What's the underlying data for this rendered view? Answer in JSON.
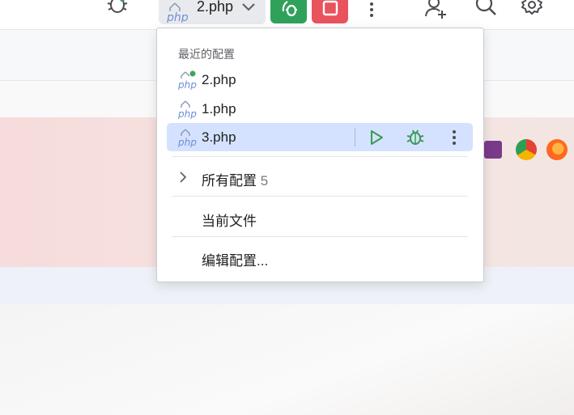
{
  "toolbar": {
    "run_config_name": "2.php",
    "php_badge": "php",
    "icons": [
      "bug-icon",
      "php-file-icon",
      "chevron-down-icon",
      "debug-icon",
      "stop-icon",
      "more-vertical-icon",
      "add-user-icon",
      "search-icon",
      "gear-icon"
    ],
    "colors": {
      "debug_bg": "#2fa15a",
      "stop_bg": "#e8535e"
    }
  },
  "popup": {
    "section_title": "最近的配置",
    "recent": [
      {
        "label": "2.php",
        "badge": "php",
        "running": true
      },
      {
        "label": "1.php",
        "badge": "php",
        "running": false
      },
      {
        "label": "3.php",
        "badge": "php",
        "running": false,
        "selected": true
      }
    ],
    "all_configs": {
      "label": "所有配置",
      "count": "5"
    },
    "current_file": "当前文件",
    "edit_configs": "编辑配置...",
    "colors": {
      "selected_bg": "#d4e2ff",
      "run_green": "#3a9a55"
    }
  }
}
